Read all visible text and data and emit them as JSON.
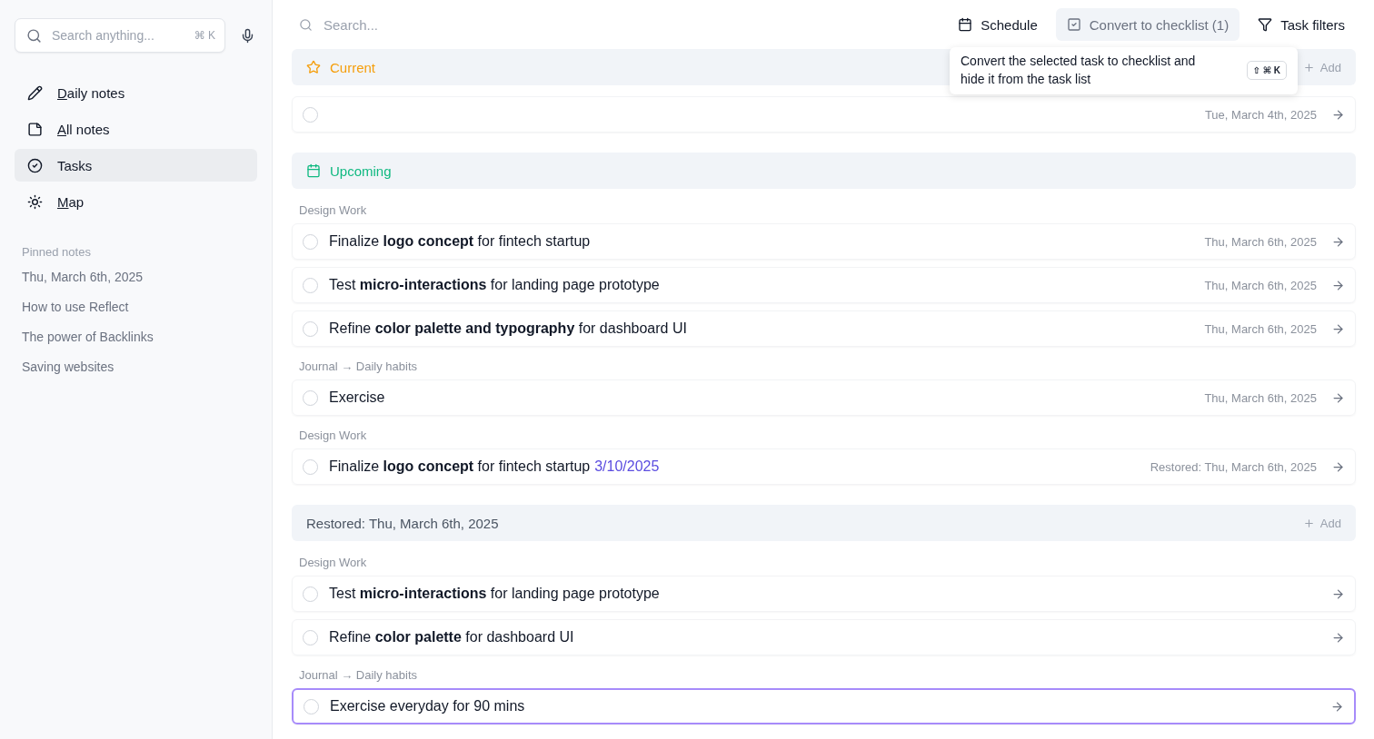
{
  "sidebar": {
    "search": {
      "placeholder": "Search anything...",
      "shortcut": "⌘ K"
    },
    "nav": [
      {
        "label": "Daily notes",
        "selected": false,
        "underline_first": true
      },
      {
        "label": "All notes",
        "selected": false,
        "underline_first": true
      },
      {
        "label": "Tasks",
        "selected": true,
        "underline_first": false
      },
      {
        "label": "Map",
        "selected": false,
        "underline_first": true
      }
    ],
    "pinned_title": "Pinned notes",
    "pinned": [
      "Thu, March 6th, 2025",
      "How to use Reflect",
      "The power of Backlinks",
      "Saving websites"
    ]
  },
  "toolbar": {
    "search_placeholder": "Search...",
    "buttons": [
      {
        "label": "Schedule",
        "selected": false
      },
      {
        "label": "Convert to checklist (1)",
        "selected": true
      },
      {
        "label": "Task filters",
        "selected": false
      }
    ]
  },
  "tooltip": {
    "text": "Convert the selected task to checklist and hide it from the task list",
    "shortcut": "⇧ ⌘ K"
  },
  "sections": [
    {
      "kind": "current",
      "title": "Current",
      "add": "Add",
      "groups": [
        {
          "tasks": [
            {
              "date": "Tue, March 4th, 2025",
              "checked": false,
              "selected": false
            }
          ]
        }
      ]
    },
    {
      "kind": "upcoming",
      "title": "Upcoming",
      "groups": [
        {
          "label": "Design Work",
          "tasks": [
            {
              "text": "Finalize **logo concept** for fintech startup",
              "date": "Thu, March 6th, 2025",
              "checked": false,
              "selected": false
            },
            {
              "text": "Test **micro-interactions** for landing page prototype",
              "date": "Thu, March 6th, 2025",
              "checked": false,
              "selected": false
            },
            {
              "text": "Refine **color palette and typography** for dashboard UI",
              "date": "Thu, March 6th, 2025",
              "checked": false,
              "selected": false
            }
          ]
        },
        {
          "label": "Journal → Daily habits",
          "tasks": [
            {
              "text": "Exercise",
              "date": "Thu, March 6th, 2025",
              "checked": false,
              "selected": false
            }
          ]
        },
        {
          "label": "Design Work",
          "tasks": [
            {
              "text": "Finalize **logo concept** for fintech startup",
              "link": "3/10/2025",
              "date": "Restored: Thu, March 6th, 2025",
              "checked": false,
              "selected": false
            }
          ]
        }
      ]
    },
    {
      "kind": "restored",
      "title": "Restored: Thu, March 6th, 2025",
      "add": "Add",
      "groups": [
        {
          "label": "Design Work",
          "tasks": [
            {
              "text": "Test **micro-interactions** for landing page prototype",
              "checked": false,
              "selected": false
            },
            {
              "text": "Refine **color palette** for dashboard UI",
              "checked": false,
              "selected": false
            }
          ]
        },
        {
          "label": "Journal → Daily habits",
          "tasks": [
            {
              "text": "Exercise everyday for 90 mins",
              "checked": false,
              "selected": true
            }
          ]
        }
      ]
    }
  ]
}
